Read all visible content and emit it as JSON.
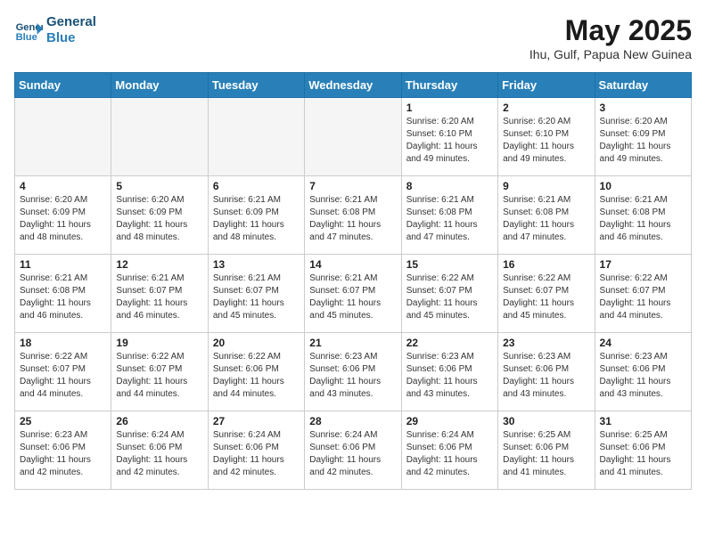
{
  "header": {
    "logo_line1": "General",
    "logo_line2": "Blue",
    "month_title": "May 2025",
    "location": "Ihu, Gulf, Papua New Guinea"
  },
  "days_of_week": [
    "Sunday",
    "Monday",
    "Tuesday",
    "Wednesday",
    "Thursday",
    "Friday",
    "Saturday"
  ],
  "weeks": [
    [
      {
        "day": "",
        "info": ""
      },
      {
        "day": "",
        "info": ""
      },
      {
        "day": "",
        "info": ""
      },
      {
        "day": "",
        "info": ""
      },
      {
        "day": "1",
        "info": "Sunrise: 6:20 AM\nSunset: 6:10 PM\nDaylight: 11 hours\nand 49 minutes."
      },
      {
        "day": "2",
        "info": "Sunrise: 6:20 AM\nSunset: 6:10 PM\nDaylight: 11 hours\nand 49 minutes."
      },
      {
        "day": "3",
        "info": "Sunrise: 6:20 AM\nSunset: 6:09 PM\nDaylight: 11 hours\nand 49 minutes."
      }
    ],
    [
      {
        "day": "4",
        "info": "Sunrise: 6:20 AM\nSunset: 6:09 PM\nDaylight: 11 hours\nand 48 minutes."
      },
      {
        "day": "5",
        "info": "Sunrise: 6:20 AM\nSunset: 6:09 PM\nDaylight: 11 hours\nand 48 minutes."
      },
      {
        "day": "6",
        "info": "Sunrise: 6:21 AM\nSunset: 6:09 PM\nDaylight: 11 hours\nand 48 minutes."
      },
      {
        "day": "7",
        "info": "Sunrise: 6:21 AM\nSunset: 6:08 PM\nDaylight: 11 hours\nand 47 minutes."
      },
      {
        "day": "8",
        "info": "Sunrise: 6:21 AM\nSunset: 6:08 PM\nDaylight: 11 hours\nand 47 minutes."
      },
      {
        "day": "9",
        "info": "Sunrise: 6:21 AM\nSunset: 6:08 PM\nDaylight: 11 hours\nand 47 minutes."
      },
      {
        "day": "10",
        "info": "Sunrise: 6:21 AM\nSunset: 6:08 PM\nDaylight: 11 hours\nand 46 minutes."
      }
    ],
    [
      {
        "day": "11",
        "info": "Sunrise: 6:21 AM\nSunset: 6:08 PM\nDaylight: 11 hours\nand 46 minutes."
      },
      {
        "day": "12",
        "info": "Sunrise: 6:21 AM\nSunset: 6:07 PM\nDaylight: 11 hours\nand 46 minutes."
      },
      {
        "day": "13",
        "info": "Sunrise: 6:21 AM\nSunset: 6:07 PM\nDaylight: 11 hours\nand 45 minutes."
      },
      {
        "day": "14",
        "info": "Sunrise: 6:21 AM\nSunset: 6:07 PM\nDaylight: 11 hours\nand 45 minutes."
      },
      {
        "day": "15",
        "info": "Sunrise: 6:22 AM\nSunset: 6:07 PM\nDaylight: 11 hours\nand 45 minutes."
      },
      {
        "day": "16",
        "info": "Sunrise: 6:22 AM\nSunset: 6:07 PM\nDaylight: 11 hours\nand 45 minutes."
      },
      {
        "day": "17",
        "info": "Sunrise: 6:22 AM\nSunset: 6:07 PM\nDaylight: 11 hours\nand 44 minutes."
      }
    ],
    [
      {
        "day": "18",
        "info": "Sunrise: 6:22 AM\nSunset: 6:07 PM\nDaylight: 11 hours\nand 44 minutes."
      },
      {
        "day": "19",
        "info": "Sunrise: 6:22 AM\nSunset: 6:07 PM\nDaylight: 11 hours\nand 44 minutes."
      },
      {
        "day": "20",
        "info": "Sunrise: 6:22 AM\nSunset: 6:06 PM\nDaylight: 11 hours\nand 44 minutes."
      },
      {
        "day": "21",
        "info": "Sunrise: 6:23 AM\nSunset: 6:06 PM\nDaylight: 11 hours\nand 43 minutes."
      },
      {
        "day": "22",
        "info": "Sunrise: 6:23 AM\nSunset: 6:06 PM\nDaylight: 11 hours\nand 43 minutes."
      },
      {
        "day": "23",
        "info": "Sunrise: 6:23 AM\nSunset: 6:06 PM\nDaylight: 11 hours\nand 43 minutes."
      },
      {
        "day": "24",
        "info": "Sunrise: 6:23 AM\nSunset: 6:06 PM\nDaylight: 11 hours\nand 43 minutes."
      }
    ],
    [
      {
        "day": "25",
        "info": "Sunrise: 6:23 AM\nSunset: 6:06 PM\nDaylight: 11 hours\nand 42 minutes."
      },
      {
        "day": "26",
        "info": "Sunrise: 6:24 AM\nSunset: 6:06 PM\nDaylight: 11 hours\nand 42 minutes."
      },
      {
        "day": "27",
        "info": "Sunrise: 6:24 AM\nSunset: 6:06 PM\nDaylight: 11 hours\nand 42 minutes."
      },
      {
        "day": "28",
        "info": "Sunrise: 6:24 AM\nSunset: 6:06 PM\nDaylight: 11 hours\nand 42 minutes."
      },
      {
        "day": "29",
        "info": "Sunrise: 6:24 AM\nSunset: 6:06 PM\nDaylight: 11 hours\nand 42 minutes."
      },
      {
        "day": "30",
        "info": "Sunrise: 6:25 AM\nSunset: 6:06 PM\nDaylight: 11 hours\nand 41 minutes."
      },
      {
        "day": "31",
        "info": "Sunrise: 6:25 AM\nSunset: 6:06 PM\nDaylight: 11 hours\nand 41 minutes."
      }
    ]
  ]
}
